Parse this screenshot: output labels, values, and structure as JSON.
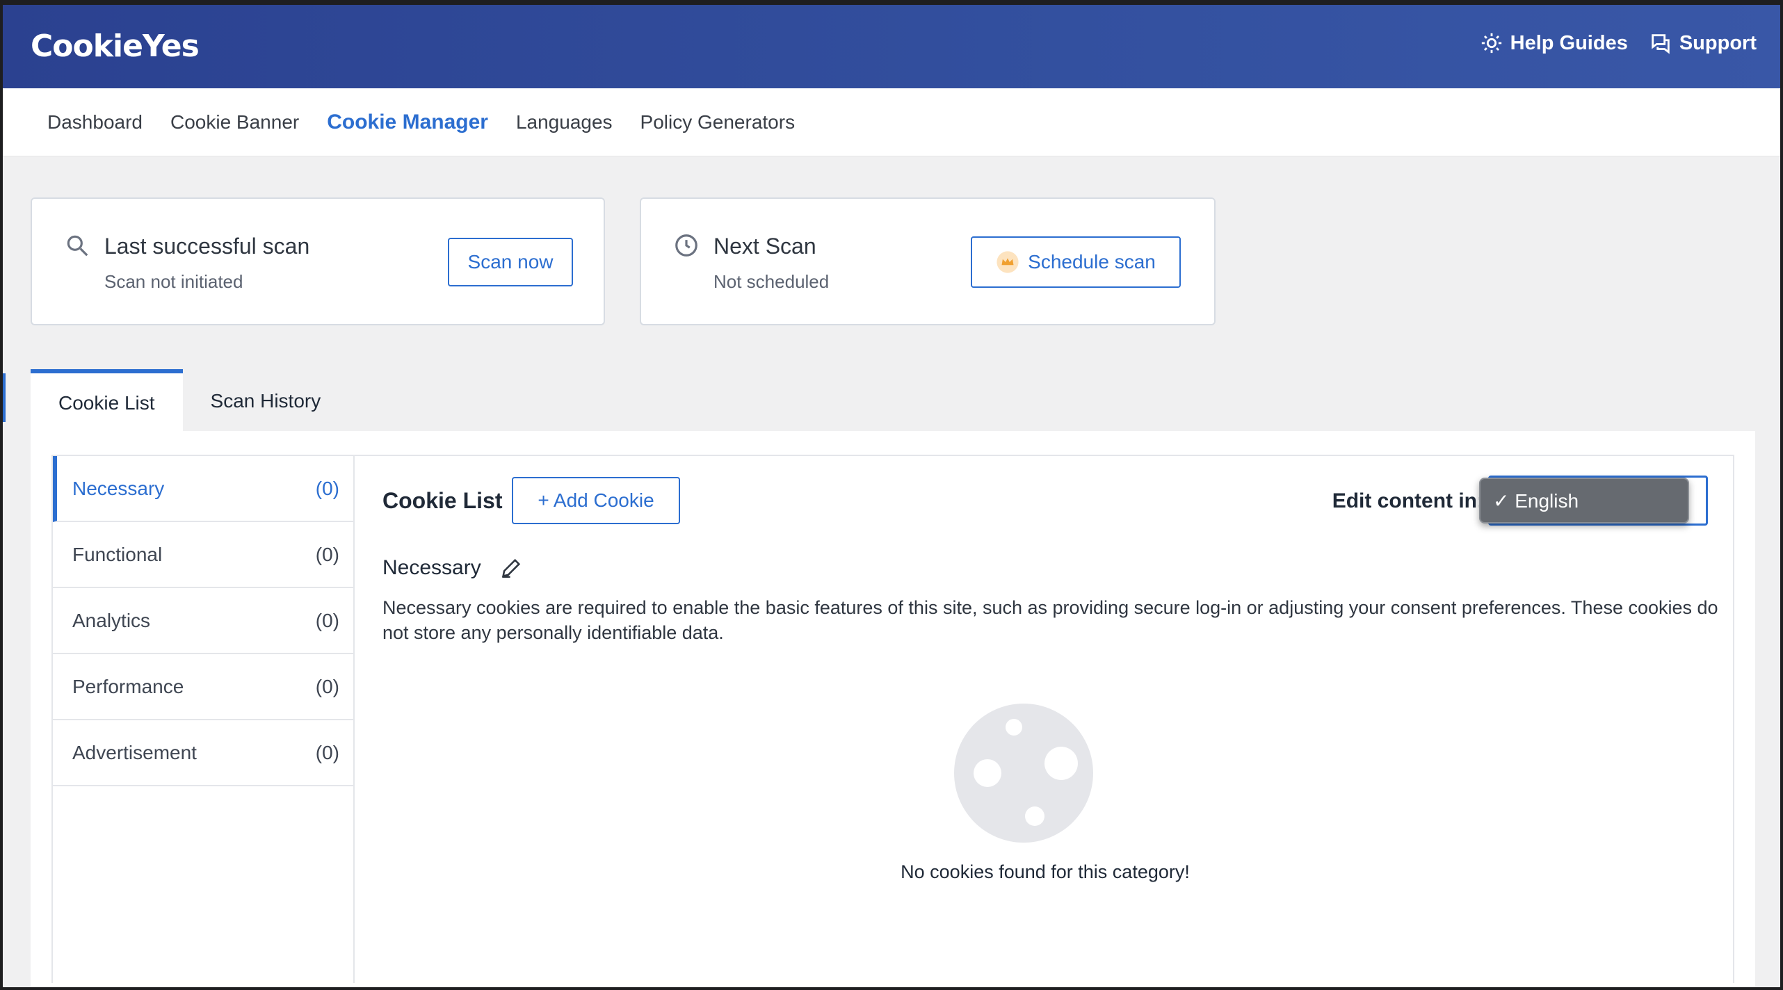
{
  "header": {
    "logo": "CookieYes",
    "links": [
      {
        "label": "Help Guides",
        "icon": "gear-help-icon"
      },
      {
        "label": "Support",
        "icon": "chat-icon"
      }
    ]
  },
  "nav": {
    "items": [
      "Dashboard",
      "Cookie Banner",
      "Cookie Manager",
      "Languages",
      "Policy Generators"
    ],
    "active": "Cookie Manager"
  },
  "scan_cards": {
    "last": {
      "title": "Last successful scan",
      "status": "Scan not initiated",
      "button": "Scan now"
    },
    "next": {
      "title": "Next Scan",
      "status": "Not scheduled",
      "button": "Schedule scan"
    }
  },
  "tabs": {
    "items": [
      "Cookie List",
      "Scan History"
    ],
    "active": "Cookie List"
  },
  "categories": [
    {
      "name": "Necessary",
      "count": "(0)"
    },
    {
      "name": "Functional",
      "count": "(0)"
    },
    {
      "name": "Analytics",
      "count": "(0)"
    },
    {
      "name": "Performance",
      "count": "(0)"
    },
    {
      "name": "Advertisement",
      "count": "(0)"
    }
  ],
  "content": {
    "title": "Cookie List",
    "add_button": "+ Add Cookie",
    "edit_label": "Edit content in:",
    "language_option": "✓ English",
    "section_title": "Necessary",
    "description": "Necessary cookies are required to enable the basic features of this site, such as providing secure log-in or adjusting your consent preferences. These cookies do not store any personally identifiable data.",
    "empty_message": "No cookies found for this category!"
  },
  "colors": {
    "header_bg": "#2b4190",
    "accent": "#2c6ed0",
    "page_bg": "#f0f0f1"
  }
}
